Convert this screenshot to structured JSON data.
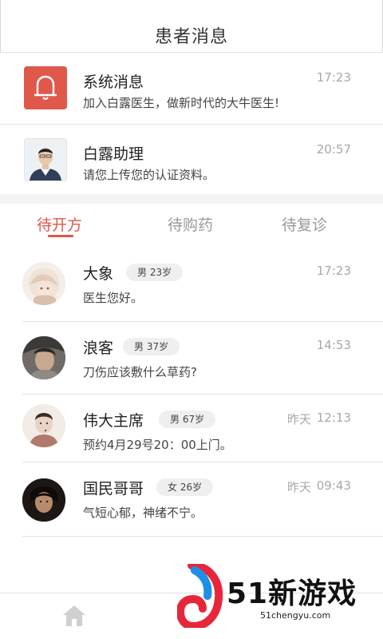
{
  "header": {
    "title": "患者消息"
  },
  "system": {
    "name": "系统消息",
    "message": "加入白露医生，做新时代的大牛医生!",
    "time": "17:23",
    "icon": "bell-icon"
  },
  "assistant": {
    "name": "白露助理",
    "message": "请您上传您的认证资料。",
    "time": "20:57"
  },
  "tabs": [
    {
      "label": "待开方",
      "active": true
    },
    {
      "label": "待购药",
      "active": false
    },
    {
      "label": "待复诊",
      "active": false
    }
  ],
  "patients": [
    {
      "name": "大象",
      "badge": "男 23岁",
      "message": "医生您好。",
      "day": "",
      "time": "17:23"
    },
    {
      "name": "浪客",
      "badge": "男 37岁",
      "message": "刀伤应该敷什么草药?",
      "day": "",
      "time": "14:53"
    },
    {
      "name": "伟大主席",
      "badge": "男 67岁",
      "message": "预约4月29号20：00上门。",
      "day": "昨天",
      "time": "12:13"
    },
    {
      "name": "国民哥哥",
      "badge": "女 26岁",
      "message": "气短心郁，神绪不宁。",
      "day": "昨天",
      "time": "09:43"
    }
  ],
  "bottom_nav": {
    "home_icon": "home-icon"
  },
  "watermark": {
    "brand": "51新游戏",
    "url": "51chengyu.com"
  },
  "colors": {
    "accent": "#e0584a",
    "muted": "#a8a8a8"
  }
}
